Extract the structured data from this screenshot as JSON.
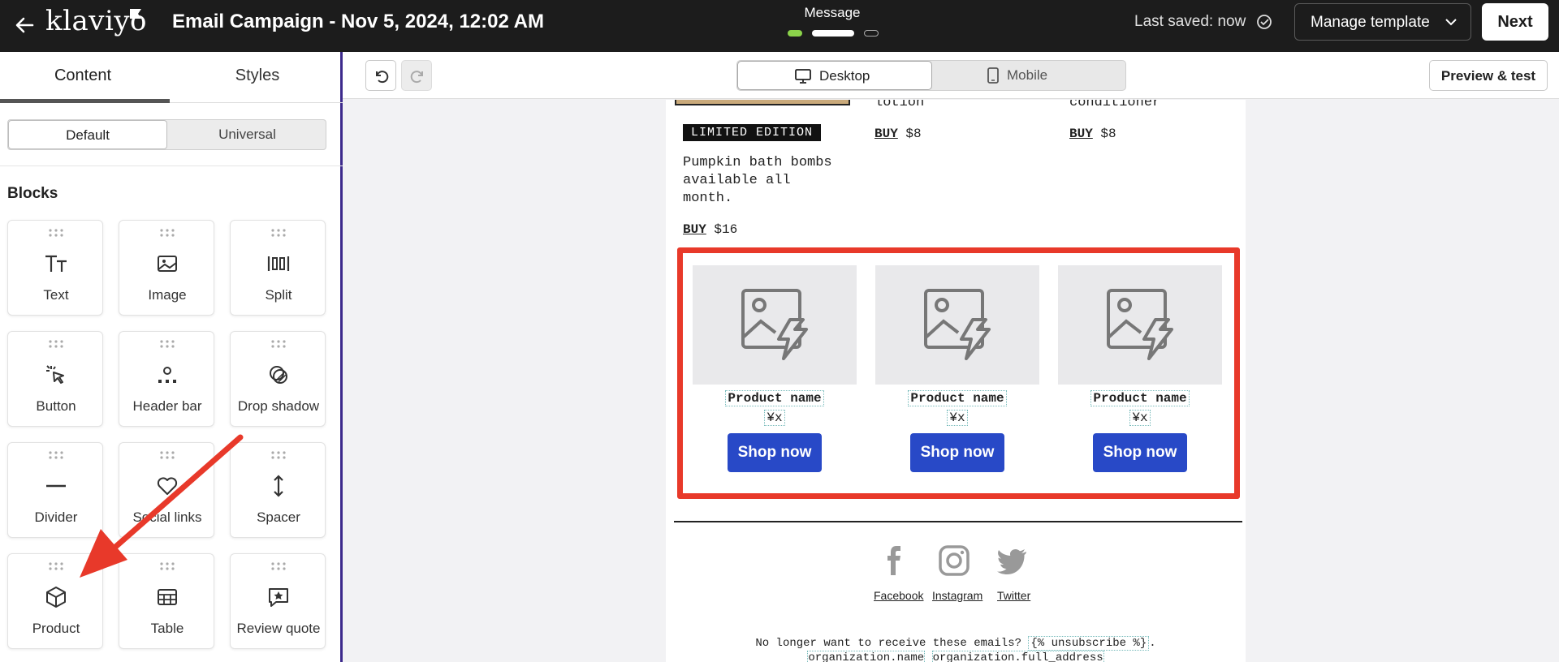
{
  "topbar": {
    "logo": "klaviyo",
    "title": "Email Campaign - Nov 5, 2024, 12:02 AM",
    "step_label": "Message",
    "saved": "Last saved: now",
    "manage_label": "Manage template",
    "next_label": "Next"
  },
  "sidebar": {
    "tabs": [
      "Content",
      "Styles"
    ],
    "segment": [
      "Default",
      "Universal"
    ],
    "blocks_heading": "Blocks",
    "blocks": [
      {
        "label": "Text",
        "icon": "text-icon"
      },
      {
        "label": "Image",
        "icon": "image-icon"
      },
      {
        "label": "Split",
        "icon": "split-icon"
      },
      {
        "label": "Button",
        "icon": "cursor-click-icon"
      },
      {
        "label": "Header bar",
        "icon": "header-bar-icon"
      },
      {
        "label": "Drop shadow",
        "icon": "drop-shadow-icon"
      },
      {
        "label": "Divider",
        "icon": "divider-icon"
      },
      {
        "label": "Social links",
        "icon": "heart-icon"
      },
      {
        "label": "Spacer",
        "icon": "spacer-icon"
      },
      {
        "label": "Product",
        "icon": "cube-icon"
      },
      {
        "label": "Table",
        "icon": "table-icon"
      },
      {
        "label": "Review quote",
        "icon": "review-star-icon"
      }
    ]
  },
  "toolbar": {
    "desktop_label": "Desktop",
    "mobile_label": "Mobile",
    "preview_label": "Preview & test"
  },
  "email": {
    "col2_name": "lotion",
    "col3_name": "conditioner",
    "buy_word": "BUY",
    "col2_price": "$8",
    "col3_price": "$8",
    "badge": "LIMITED EDITION",
    "desc_lines": [
      "Pumpkin bath bombs",
      "available all",
      "month."
    ],
    "col1_price": "$16",
    "products": [
      {
        "name": "Product name",
        "price": "¥x",
        "button": "Shop now"
      },
      {
        "name": "Product name",
        "price": "¥x",
        "button": "Shop now"
      },
      {
        "name": "Product name",
        "price": "¥x",
        "button": "Shop now"
      }
    ],
    "social": [
      "Facebook",
      "Instagram",
      "Twitter"
    ],
    "footer_text": "No longer want to receive these emails?",
    "footer_tag": "{% unsubscribe %}",
    "footer_line2_a": "organization.name",
    "footer_line2_b": "organization.full_address"
  },
  "colors": {
    "accent_blue": "#2849c7",
    "annotation_red": "#e8392a",
    "step_active": "#8bd34a",
    "sidebar_border": "#3d2a8c"
  }
}
